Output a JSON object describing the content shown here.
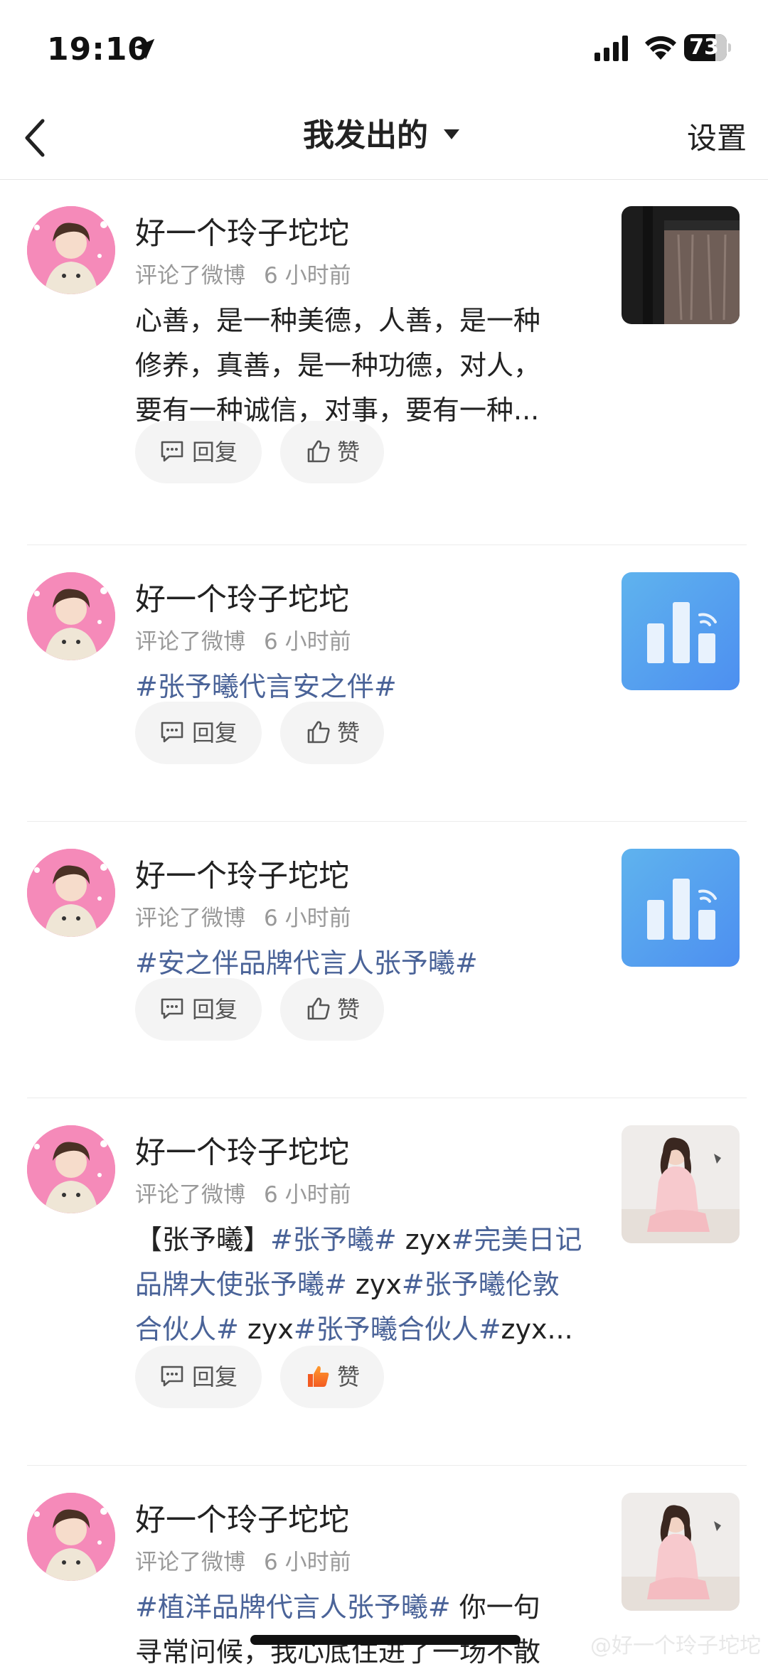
{
  "status_bar": {
    "time": "19:10",
    "battery": "73"
  },
  "nav": {
    "title": "我发出的",
    "settings": "设置"
  },
  "items": [
    {
      "username": "好一个玲子坨坨",
      "action": "评论了微博",
      "time": "6 小时前",
      "content_lines": [
        "心善，是一种美德，人善，是一种",
        "修养，真善，是一种功德，对人，",
        "要有一种诚信，对事，要有一种..."
      ],
      "reply": "回复",
      "like": "赞",
      "liked": false,
      "thumb": "dark-photo"
    },
    {
      "username": "好一个玲子坨坨",
      "action": "评论了微博",
      "time": "6 小时前",
      "tag": "#张予曦代言安之伴#",
      "reply": "回复",
      "like": "赞",
      "liked": false,
      "thumb": "blue-chart"
    },
    {
      "username": "好一个玲子坨坨",
      "action": "评论了微博",
      "time": "6 小时前",
      "tag": "#安之伴品牌代言人张予曦#",
      "reply": "回复",
      "like": "赞",
      "liked": false,
      "thumb": "blue-chart"
    },
    {
      "username": "好一个玲子坨坨",
      "action": "评论了微博",
      "time": "6 小时前",
      "rich_lines": [
        [
          {
            "t": "【张予曦】",
            "tag": false
          },
          {
            "t": "#张予曦#",
            "tag": true
          },
          {
            "t": " zyx",
            "tag": false
          },
          {
            "t": "#完美日记",
            "tag": true
          }
        ],
        [
          {
            "t": "品牌大使张予曦#",
            "tag": true
          },
          {
            "t": " zyx",
            "tag": false
          },
          {
            "t": "#张予曦伦敦",
            "tag": true
          }
        ],
        [
          {
            "t": "合伙人#",
            "tag": true
          },
          {
            "t": " zyx",
            "tag": false
          },
          {
            "t": "#张予曦合伙人#",
            "tag": true
          },
          {
            "t": "zyx...",
            "tag": false
          }
        ]
      ],
      "reply": "回复",
      "like": "赞",
      "liked": true,
      "thumb": "pink-photo"
    },
    {
      "username": "好一个玲子坨坨",
      "action": "评论了微博",
      "time": "6 小时前",
      "rich_lines": [
        [
          {
            "t": "#植洋品牌代言人张予曦#",
            "tag": true
          },
          {
            "t": " 你一句",
            "tag": false
          }
        ],
        [
          {
            "t": "寻常问候，我心底住进了一场不散",
            "tag": false
          }
        ]
      ],
      "thumb": "pink-photo"
    }
  ],
  "watermark": "@好一个玲子坨坨"
}
